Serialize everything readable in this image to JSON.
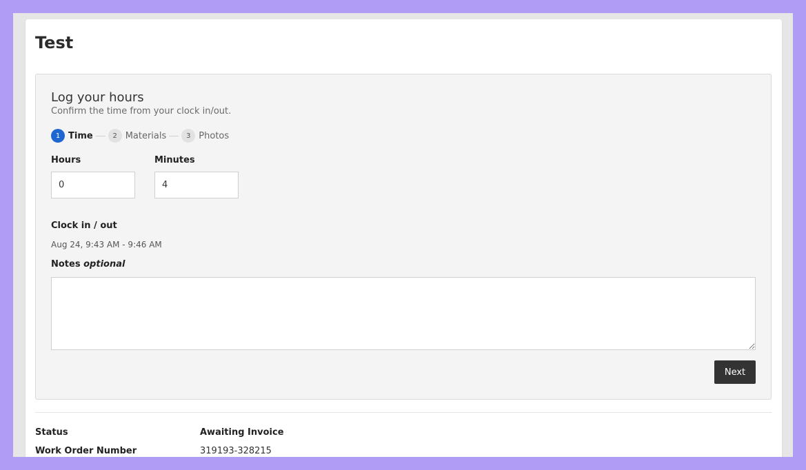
{
  "page": {
    "title": "Test"
  },
  "log_hours": {
    "title": "Log your hours",
    "subtitle": "Confirm the time from your clock in/out.",
    "steps": [
      {
        "number": "1",
        "label": "Time",
        "active": true
      },
      {
        "number": "2",
        "label": "Materials",
        "active": false
      },
      {
        "number": "3",
        "label": "Photos",
        "active": false
      }
    ],
    "hours_label": "Hours",
    "hours_value": "0",
    "minutes_label": "Minutes",
    "minutes_value": "4",
    "clock_label": "Clock in / out",
    "clock_value": "Aug 24, 9:43 AM - 9:46 AM",
    "notes_label": "Notes",
    "notes_optional": "optional",
    "notes_value": "",
    "next_label": "Next"
  },
  "details": [
    {
      "key": "Status",
      "value": "Awaiting Invoice"
    },
    {
      "key": "Work Order Number",
      "value": "319193-328215"
    }
  ],
  "colors": {
    "background": "#b09cf5",
    "step_active": "#1f66d1",
    "next_button": "#333333"
  }
}
